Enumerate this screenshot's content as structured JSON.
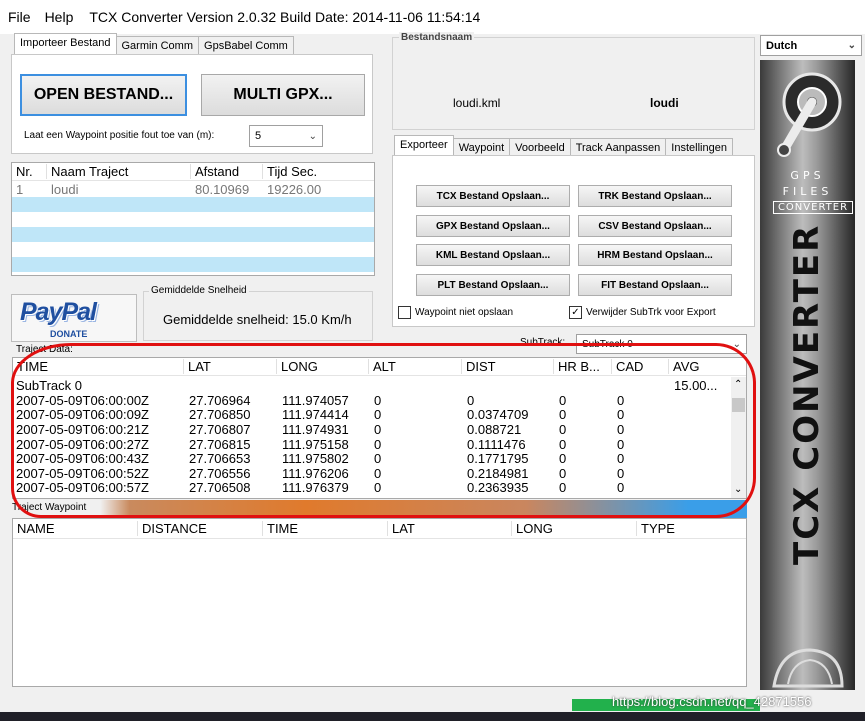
{
  "menu": {
    "file": "File",
    "help": "Help",
    "title": "TCX Converter Version 2.0.32 Build Date: 2014-11-06 11:54:14"
  },
  "left_tabs": [
    "Importeer Bestand",
    "Garmin Comm",
    "GpsBabel Comm"
  ],
  "import": {
    "open_button": "OPEN BESTAND...",
    "multi_button": "MULTI GPX...",
    "waypoint_label": "Laat een Waypoint positie fout toe van (m):",
    "waypoint_value": "5"
  },
  "traject_table": {
    "headers": [
      "Nr.",
      "Naam Traject",
      "Afstand",
      "Tijd Sec."
    ],
    "rows": [
      [
        "1",
        "loudi",
        "80.10969",
        "19226.00"
      ]
    ]
  },
  "bestandsnaam": {
    "label": "Bestandsnaam",
    "file": "loudi.kml",
    "name": "loudi"
  },
  "language": {
    "value": "Dutch"
  },
  "right_tabs": [
    "Exporteer",
    "Waypoint",
    "Voorbeeld",
    "Track Aanpassen",
    "Instellingen"
  ],
  "export_buttons": [
    "TCX Bestand Opslaan...",
    "TRK Bestand Opslaan...",
    "GPX Bestand Opslaan...",
    "CSV Bestand Opslaan...",
    "KML Bestand Opslaan...",
    "HRM Bestand Opslaan...",
    "PLT Bestand Opslaan...",
    "FIT Bestand Opslaan..."
  ],
  "checkboxes": {
    "waypoint_niet": "Waypoint niet opslaan",
    "verwijder": "Verwijder SubTrk voor Export"
  },
  "paypal": {
    "brand": "PayPal",
    "donate": "DONATE"
  },
  "speed": {
    "label": "Gemiddelde Snelheid",
    "value": "Gemiddelde snelheid: 15.0 Km/h"
  },
  "traject_data": {
    "label": "Traject Data:",
    "subtrack_label": "SubTrack:",
    "subtrack_value": "SubTrack 0",
    "headers": [
      "TIME",
      "LAT",
      "LONG",
      "ALT",
      "DIST",
      "HR B...",
      "CAD",
      "AVG"
    ],
    "group": "SubTrack 0",
    "group_avg": "15.00...",
    "rows": [
      [
        "2007-05-09T06:00:00Z",
        "27.706964",
        "111.974057",
        "0",
        "0",
        "0",
        "0"
      ],
      [
        "2007-05-09T06:00:09Z",
        "27.706850",
        "111.974414",
        "0",
        "0.0374709",
        "0",
        "0"
      ],
      [
        "2007-05-09T06:00:21Z",
        "27.706807",
        "111.974931",
        "0",
        "0.088721",
        "0",
        "0"
      ],
      [
        "2007-05-09T06:00:27Z",
        "27.706815",
        "111.975158",
        "0",
        "0.1111476",
        "0",
        "0"
      ],
      [
        "2007-05-09T06:00:43Z",
        "27.706653",
        "111.975802",
        "0",
        "0.1771795",
        "0",
        "0"
      ],
      [
        "2007-05-09T06:00:52Z",
        "27.706556",
        "111.976206",
        "0",
        "0.2184981",
        "0",
        "0"
      ],
      [
        "2007-05-09T06:00:57Z",
        "27.706508",
        "111.976379",
        "0",
        "0.2363935",
        "0",
        "0"
      ]
    ]
  },
  "traject_waypoint": {
    "label": "Traject Waypoint",
    "headers": [
      "NAME",
      "DISTANCE",
      "TIME",
      "LAT",
      "LONG",
      "TYPE"
    ]
  },
  "logo": {
    "line1": "GPS",
    "line2": "FILES",
    "line3": "CONVERTER",
    "vertical": "TCX CONVERTER"
  },
  "watermark": "https://blog.csdn.net/qq_42871556",
  "colors": {
    "accent_blue": "#3c8fe0",
    "row_stripe": "#bfe6f8",
    "annotation_red": "#e01010",
    "status_green": "#22b14c"
  }
}
